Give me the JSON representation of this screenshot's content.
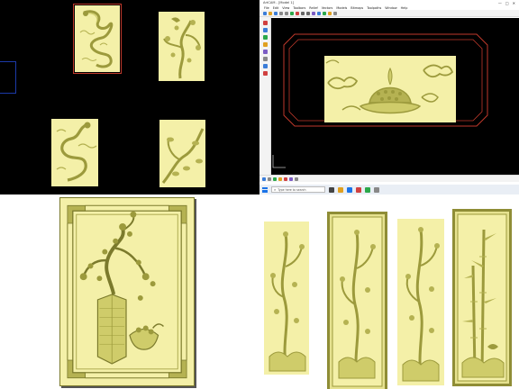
{
  "colors": {
    "relief_fill": "#f4f0a8",
    "relief_shadow": "#9c9a3c",
    "relief_mid": "#cfcc6a",
    "background_dark": "#000000",
    "selection_red": "#c0392b",
    "selection_blue": "#1c3aa8"
  },
  "panels": {
    "top_left": {
      "reliefs": [
        {
          "name": "dragon-panel",
          "subject": "dragon",
          "icon": "dragon-relief"
        },
        {
          "name": "plum-bird-panel",
          "subject": "plum blossom with bird",
          "icon": "plum-relief"
        },
        {
          "name": "dragon-panel-2",
          "subject": "dragon",
          "icon": "dragon-relief"
        },
        {
          "name": "branch-panel",
          "subject": "flowering branch",
          "icon": "branch-relief"
        }
      ]
    },
    "top_right": {
      "window_title": "ArtCAM - [Model 1]",
      "window_controls": [
        "—",
        "□",
        "✕"
      ],
      "menu": [
        "File",
        "Edit",
        "View",
        "Toolbars",
        "Relief",
        "Vectors",
        "Models",
        "Bitmaps",
        "Toolpaths",
        "Window",
        "Help"
      ],
      "taskbar": {
        "search_placeholder": "Type here to search",
        "tray_time": ""
      },
      "canvas_relief": {
        "subject": "lotus vase with clouds",
        "icon": "lotus-cloud-relief"
      }
    },
    "bottom_left": {
      "relief": {
        "subject": "flowering plum in hexagonal vase with fruit bowl, framed border",
        "icon": "plum-vase-relief"
      }
    },
    "bottom_right": {
      "reliefs": [
        {
          "name": "panel-plum",
          "icon": "plum-tall-relief"
        },
        {
          "name": "panel-plum-framed",
          "icon": "plum-framed-relief"
        },
        {
          "name": "panel-orchid",
          "icon": "orchid-tall-relief"
        },
        {
          "name": "panel-bamboo-framed",
          "icon": "bamboo-framed-relief"
        }
      ]
    }
  }
}
